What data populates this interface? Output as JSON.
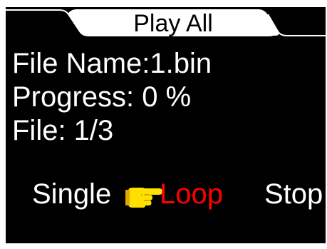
{
  "header": {
    "title": "Play All"
  },
  "info": {
    "file_name": "File Name:1.bin",
    "progress": "Progress: 0 %",
    "file_count": "File: 1/3"
  },
  "options": {
    "single": "Single",
    "loop": "Loop",
    "stop": "Stop",
    "selected": "Loop",
    "selected_color": "#ff0000",
    "pointer_icon": "pointing-hand-icon",
    "pointer_color": "#ffe000"
  },
  "colors": {
    "background": "#000000",
    "text": "#ffffff",
    "tab": "#ffffff"
  }
}
